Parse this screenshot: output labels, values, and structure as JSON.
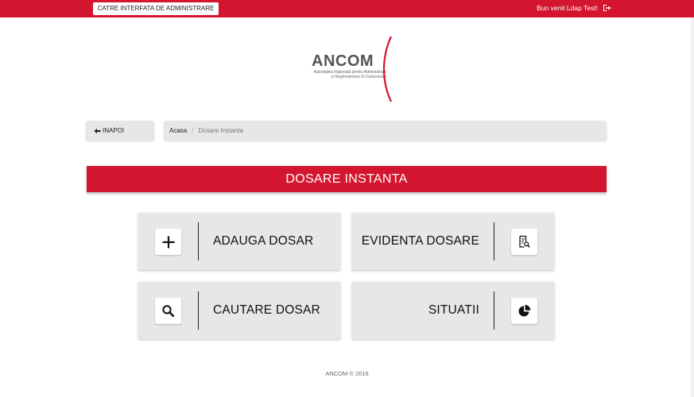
{
  "header": {
    "admin_button": "CATRE INTERFATA DE ADMINISTRARE",
    "welcome": "Bun venit Ldap Test!",
    "logout_icon": "sign-out-icon",
    "bg_color": "#d4152f"
  },
  "logo": {
    "name": "ANCOM",
    "subtitle_line1": "Autoritatea Națională pentru Administrare",
    "subtitle_line2": "și Reglementare în Comunicații"
  },
  "nav": {
    "back_label": "INAPOI",
    "back_icon": "arrow-left-icon",
    "breadcrumb": {
      "home": "Acasa",
      "separator": "/",
      "current": "Dosare Instanta"
    }
  },
  "page": {
    "title": "DOSARE INSTANTA"
  },
  "tiles": [
    {
      "label": "ADAUGA DOSAR",
      "icon": "plus-icon"
    },
    {
      "label": "EVIDENTA DOSARE",
      "icon": "document-search-icon"
    },
    {
      "label": "CAUTARE DOSAR",
      "icon": "search-icon"
    },
    {
      "label": "SITUATII",
      "icon": "pie-chart-icon"
    }
  ],
  "footer": {
    "text": "ANCOM © 2016"
  }
}
